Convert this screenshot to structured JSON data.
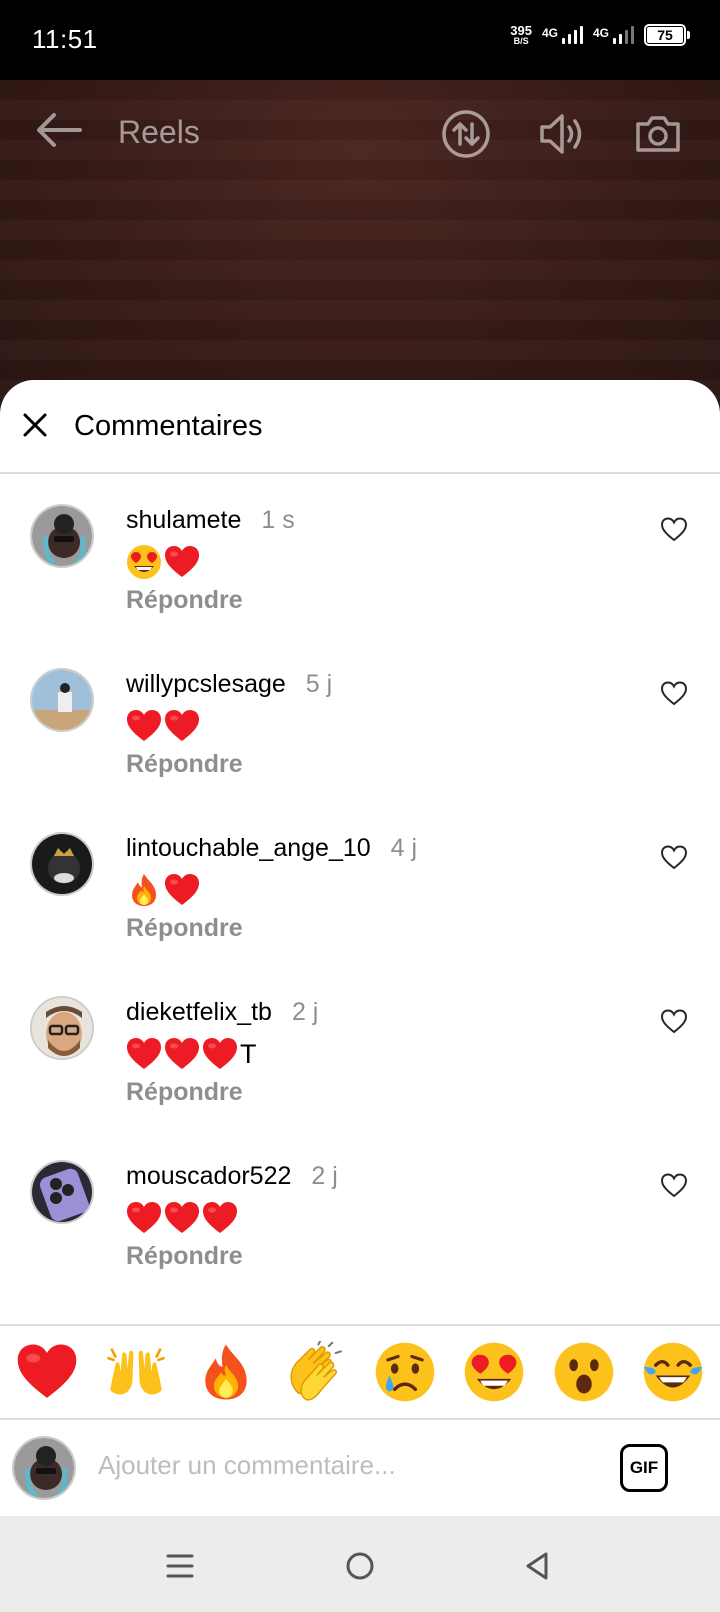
{
  "status_bar": {
    "time": "11:51",
    "net_speed": "395",
    "net_unit": "B/S",
    "sim1": "4G",
    "sim2": "4G",
    "battery": "75"
  },
  "reels": {
    "title": "Reels",
    "icons": [
      "back-arrow-icon",
      "swap-icon",
      "sound-icon",
      "camera-icon"
    ]
  },
  "sheet": {
    "title": "Commentaires"
  },
  "comments": [
    {
      "user": "shulamete",
      "time": "1 s",
      "emojis": [
        "heart-eyes",
        "heart"
      ],
      "suffix": "",
      "reply": "Répondre"
    },
    {
      "user": "willypcslesage",
      "time": "5 j",
      "emojis": [
        "heart",
        "heart"
      ],
      "suffix": "",
      "reply": "Répondre"
    },
    {
      "user": "lintouchable_ange_10",
      "time": "4 j",
      "emojis": [
        "fire",
        "heart"
      ],
      "suffix": "",
      "reply": "Répondre"
    },
    {
      "user": "dieketfelix_tb",
      "time": "2 j",
      "emojis": [
        "heart",
        "heart",
        "heart"
      ],
      "suffix": "T",
      "reply": "Répondre"
    },
    {
      "user": "mouscador522",
      "time": "2 j",
      "emojis": [
        "heart",
        "heart",
        "heart"
      ],
      "suffix": "",
      "reply": "Répondre"
    }
  ],
  "reactions": [
    "heart",
    "raised-hands",
    "fire",
    "clapping-hands",
    "crying-face",
    "heart-eyes",
    "astonished-face",
    "tears-of-joy"
  ],
  "compose": {
    "placeholder": "Ajouter un commentaire...",
    "gif_label": "GIF"
  },
  "colors": {
    "heart": "#ed1c24",
    "muted_text": "#8e8e8e",
    "divider": "#dbdbdb",
    "reels_bg": "#3a1c18"
  }
}
